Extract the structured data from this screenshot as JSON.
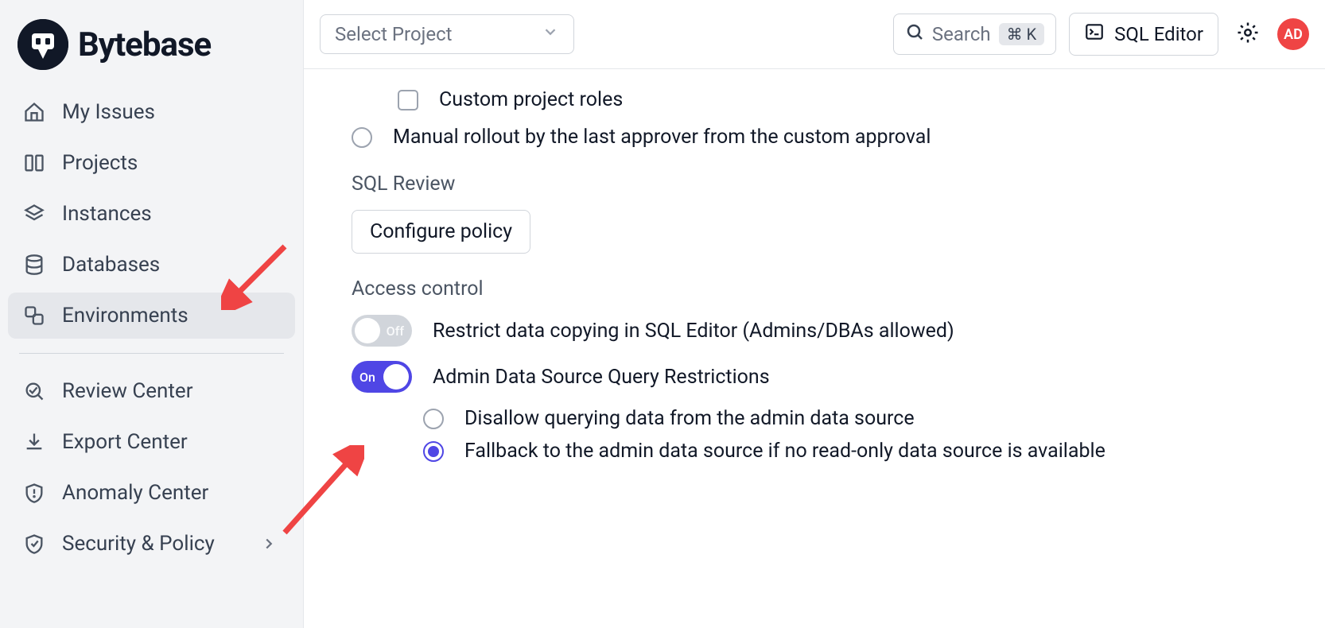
{
  "brand": {
    "name": "Bytebase"
  },
  "sidebar": {
    "items": [
      {
        "label": "My Issues"
      },
      {
        "label": "Projects"
      },
      {
        "label": "Instances"
      },
      {
        "label": "Databases"
      },
      {
        "label": "Environments"
      },
      {
        "label": "Review Center"
      },
      {
        "label": "Export Center"
      },
      {
        "label": "Anomaly Center"
      },
      {
        "label": "Security & Policy"
      }
    ]
  },
  "topbar": {
    "project_placeholder": "Select Project",
    "search_label": "Search",
    "search_shortcut": "⌘ K",
    "sql_editor_label": "SQL Editor",
    "avatar_initials": "AD"
  },
  "content": {
    "checkbox_custom_roles": "Custom project roles",
    "radio_manual_rollout": "Manual rollout by the last approver from the custom approval",
    "sql_review_title": "SQL Review",
    "configure_policy_btn": "Configure policy",
    "access_control_title": "Access control",
    "toggle_off_label": "Off",
    "toggle_on_label": "On",
    "restrict_copy_label": "Restrict data copying in SQL Editor (Admins/DBAs allowed)",
    "admin_restrictions_label": "Admin Data Source Query Restrictions",
    "radio_disallow_label": "Disallow querying data from the admin data source",
    "radio_fallback_label": "Fallback to the admin data source if no read-only data source is available"
  }
}
